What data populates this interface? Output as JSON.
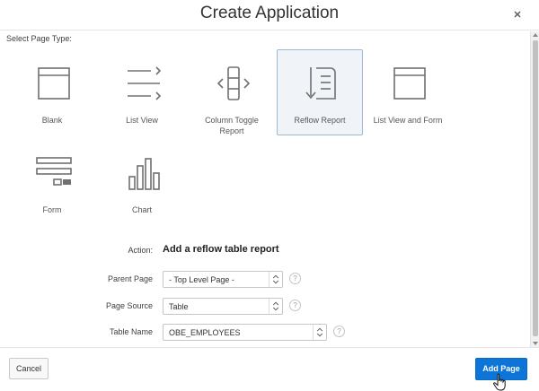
{
  "dialog": {
    "title": "Create Application",
    "close_icon": "close-icon"
  },
  "page_type": {
    "label": "Select Page Type:",
    "tiles": [
      {
        "label": "Blank",
        "icon": "blank-page-icon",
        "selected": false
      },
      {
        "label": "List View",
        "icon": "list-view-icon",
        "selected": false
      },
      {
        "label": "Column Toggle Report",
        "icon": "column-toggle-icon",
        "selected": false
      },
      {
        "label": "Reflow Report",
        "icon": "reflow-report-icon",
        "selected": true
      },
      {
        "label": "List View and Form",
        "icon": "list-view-form-icon",
        "selected": false
      },
      {
        "label": "Form",
        "icon": "form-icon",
        "selected": false
      },
      {
        "label": "Chart",
        "icon": "chart-icon",
        "selected": false
      }
    ]
  },
  "form": {
    "action_label": "Action:",
    "action_value": "Add a reflow table report",
    "parent_page_label": "Parent Page",
    "parent_page_value": "- Top Level Page -",
    "page_source_label": "Page Source",
    "page_source_value": "Table",
    "table_name_label": "Table Name",
    "table_name_value": "OBE_EMPLOYEES",
    "help_glyph": "?"
  },
  "footer": {
    "cancel_label": "Cancel",
    "add_page_label": "Add Page"
  },
  "colors": {
    "primary_button": "#0d75d8",
    "selected_tile_bg": "#f0f4f8",
    "selected_tile_border": "#9cb8d3",
    "icon_stroke": "#707070"
  }
}
